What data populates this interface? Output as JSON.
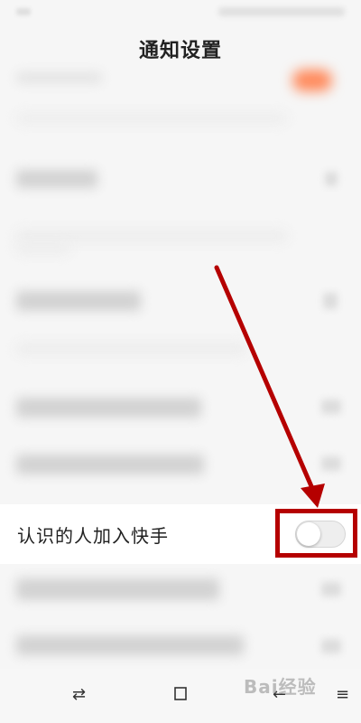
{
  "header": {
    "title": "通知设置"
  },
  "settings_row": {
    "label": "认识的人加入快手",
    "toggle_state": "off"
  },
  "annotation": {
    "color": "#b50000"
  },
  "icons": {
    "nav_back": "arrow-left-icon",
    "nav_home": "square-icon",
    "nav_switch": "switch-arrows-icon",
    "nav_menu": "menu-icon"
  },
  "watermark": {
    "text": "Bai经验"
  }
}
